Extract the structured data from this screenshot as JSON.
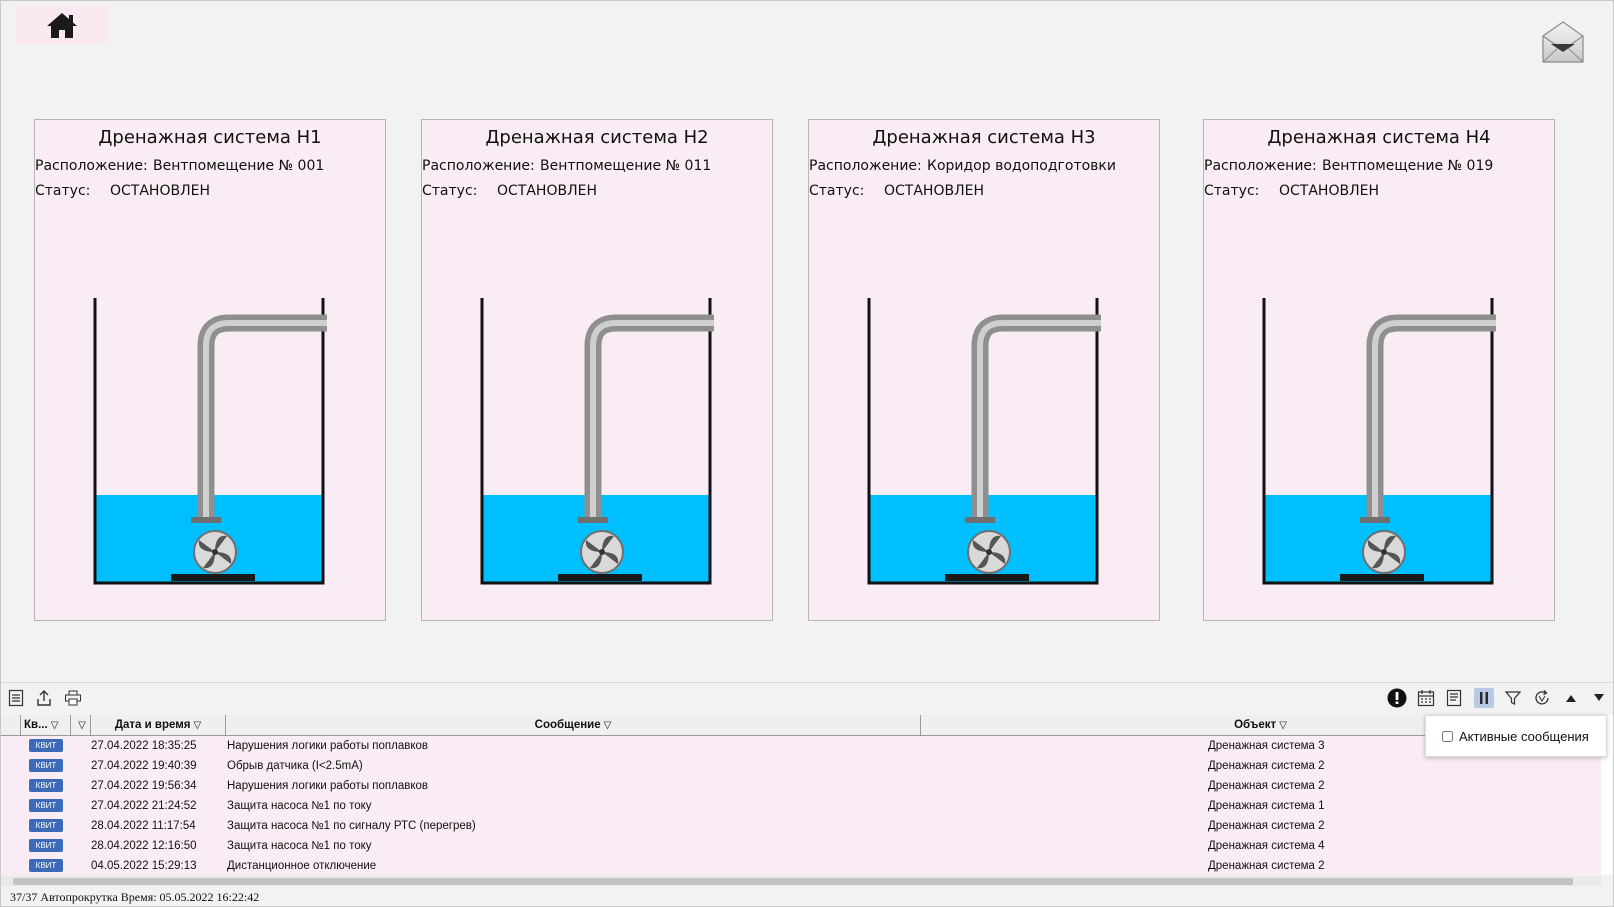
{
  "header": {
    "home_icon": "home-icon",
    "mail_icon": "envelope-icon"
  },
  "panels": [
    {
      "title": "Дренажная система Н1",
      "location_label": "Расположение:",
      "location": "Вентпомещение № 001",
      "status_label": "Статус:",
      "status": "ОСТАНОВЛЕН"
    },
    {
      "title": "Дренажная система Н2",
      "location_label": "Расположение:",
      "location": "Вентпомещение № 011",
      "status_label": "Статус:",
      "status": "ОСТАНОВЛЕН"
    },
    {
      "title": "Дренажная система Н3",
      "location_label": "Расположение:",
      "location": "Коридор водоподготовки",
      "status_label": "Статус:",
      "status": "ОСТАНОВЛЕН"
    },
    {
      "title": "Дренажная система Н4",
      "location_label": "Расположение:",
      "location": "Вентпомещение № 019",
      "status_label": "Статус:",
      "status": "ОСТАНОВЛЕН"
    }
  ],
  "colors": {
    "water": "#00bfff",
    "panel_bg": "#f9ecf4",
    "kvit_bg": "#3b6bb8",
    "pipe": "#a9a9a9"
  },
  "toolbar": {
    "left_icons": [
      "list-icon",
      "export-icon",
      "print-icon"
    ],
    "right_icons": [
      "alarm-icon",
      "calendar-icon",
      "report-icon",
      "pause-icon",
      "filter-icon",
      "refresh-icon",
      "arrow-up-icon",
      "arrow-down-icon"
    ]
  },
  "table": {
    "columns": {
      "ack": "Кв...",
      "datetime": "Дата и время",
      "message": "Сообщение",
      "object": "Объект"
    },
    "kvit_label": "КВИТ",
    "rows": [
      {
        "datetime": "27.04.2022 18:35:25",
        "message": "Нарушения логики работы поплавков",
        "object": "Дренажная система 3"
      },
      {
        "datetime": "27.04.2022 19:40:39",
        "message": "Обрыв датчика (I<2.5mA)",
        "object": "Дренажная система 2"
      },
      {
        "datetime": "27.04.2022 19:56:34",
        "message": "Нарушения логики работы поплавков",
        "object": "Дренажная система 2"
      },
      {
        "datetime": "27.04.2022 21:24:52",
        "message": "Защита насоса №1 по току",
        "object": "Дренажная система 1"
      },
      {
        "datetime": "28.04.2022 11:17:54",
        "message": "Защита насоса №1 по сигналу РТС (перегрев)",
        "object": "Дренажная система 2"
      },
      {
        "datetime": "28.04.2022 12:16:50",
        "message": "Защита насоса №1 по току",
        "object": "Дренажная система 4"
      },
      {
        "datetime": "04.05.2022 15:29:13",
        "message": "Дистанционное отключение",
        "object": "Дренажная система 2"
      }
    ]
  },
  "popup": {
    "label": "Активные сообщения",
    "checked": false
  },
  "status_bar": "37/37 Автопрокрутка Время: 05.05.2022 16:22:42"
}
